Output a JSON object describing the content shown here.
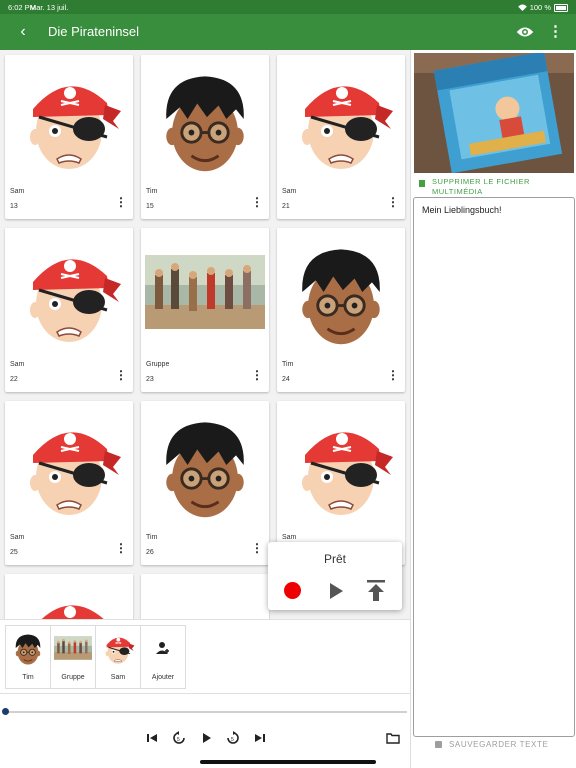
{
  "status_bar": {
    "time": "6:02 PM",
    "date": "Mar. 13 juil.",
    "battery": "100 %"
  },
  "app_bar": {
    "title": "Die Pirateninsel",
    "back_icon": "arrow-back-icon",
    "eye_icon": "eye-icon",
    "more_icon": "more-vert-icon",
    "color": "#388e3c"
  },
  "cards": [
    {
      "name": "Sam",
      "number": "13",
      "image": "pirate-avatar"
    },
    {
      "name": "Tim",
      "number": "15",
      "image": "boy-avatar"
    },
    {
      "name": "Sam",
      "number": "21",
      "image": "pirate-avatar"
    },
    {
      "name": "Sam",
      "number": "22",
      "image": "pirate-avatar"
    },
    {
      "name": "Gruppe",
      "number": "23",
      "image": "group-photo"
    },
    {
      "name": "Tim",
      "number": "24",
      "image": "boy-avatar"
    },
    {
      "name": "Sam",
      "number": "25",
      "image": "pirate-avatar"
    },
    {
      "name": "Tim",
      "number": "26",
      "image": "boy-avatar"
    },
    {
      "name": "Sam",
      "number": "",
      "image": "pirate-avatar"
    }
  ],
  "recorder": {
    "status": "Prêt",
    "record_icon": "record-icon",
    "play_icon": "play-icon",
    "upload_icon": "upload-icon",
    "record_color": "#e00000"
  },
  "sidebar": {
    "delete_label": "SUPPRIMER LE FICHIER MULTIMÉDIA",
    "text_content": "Mein Lieblingsbuch!",
    "save_label": "SAUVEGARDER TEXTE",
    "accent_color": "#43a047"
  },
  "characters": [
    {
      "label": "Tim",
      "image": "boy-avatar"
    },
    {
      "label": "Gruppe",
      "image": "group-photo"
    },
    {
      "label": "Sam",
      "image": "pirate-avatar"
    },
    {
      "label": "Ajouter",
      "image": "add-person-icon"
    }
  ],
  "player": {
    "progress": 0,
    "controls": [
      "skip-previous-icon",
      "replay-5-icon",
      "play-icon",
      "forward-5-icon",
      "skip-next-icon"
    ],
    "folder_icon": "folder-icon"
  }
}
